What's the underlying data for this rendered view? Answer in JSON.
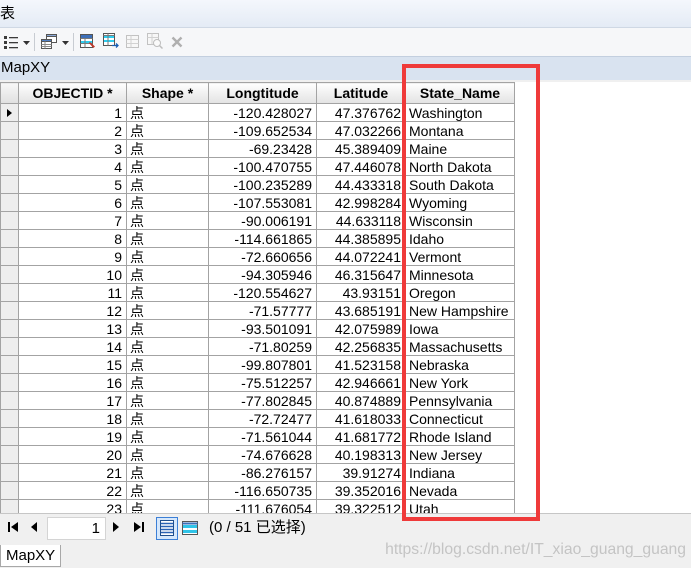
{
  "window": {
    "title": "表"
  },
  "toolbar": {
    "icons": [
      "table-options-icon",
      "related-tables-icon",
      "select-by-attributes-icon",
      "switch-selection-icon",
      "clear-selection-icon",
      "zoom-to-selected-icon",
      "delete-selected-icon"
    ],
    "disabled": [
      "clear-selection-icon",
      "zoom-to-selected-icon",
      "delete-selected-icon"
    ]
  },
  "table": {
    "name": "MapXY",
    "columns": [
      "OBJECTID *",
      "Shape *",
      "Longtitude",
      "Latitude",
      "State_Name"
    ],
    "current_row": 1,
    "rows": [
      [
        "1",
        "点",
        "-120.428027",
        "47.376762",
        "Washington"
      ],
      [
        "2",
        "点",
        "-109.652534",
        "47.032266",
        "Montana"
      ],
      [
        "3",
        "点",
        "-69.23428",
        "45.389409",
        "Maine"
      ],
      [
        "4",
        "点",
        "-100.470755",
        "47.446078",
        "North Dakota"
      ],
      [
        "5",
        "点",
        "-100.235289",
        "44.433318",
        "South Dakota"
      ],
      [
        "6",
        "点",
        "-107.553081",
        "42.998284",
        "Wyoming"
      ],
      [
        "7",
        "点",
        "-90.006191",
        "44.633118",
        "Wisconsin"
      ],
      [
        "8",
        "点",
        "-114.661865",
        "44.385895",
        "Idaho"
      ],
      [
        "9",
        "点",
        "-72.660656",
        "44.072241",
        "Vermont"
      ],
      [
        "10",
        "点",
        "-94.305946",
        "46.315647",
        "Minnesota"
      ],
      [
        "11",
        "点",
        "-120.554627",
        "43.93151",
        "Oregon"
      ],
      [
        "12",
        "点",
        "-71.57777",
        "43.685191",
        "New Hampshire"
      ],
      [
        "13",
        "点",
        "-93.501091",
        "42.075989",
        "Iowa"
      ],
      [
        "14",
        "点",
        "-71.80259",
        "42.256835",
        "Massachusetts"
      ],
      [
        "15",
        "点",
        "-99.807801",
        "41.523158",
        "Nebraska"
      ],
      [
        "16",
        "点",
        "-75.512257",
        "42.946661",
        "New York"
      ],
      [
        "17",
        "点",
        "-77.802845",
        "40.874889",
        "Pennsylvania"
      ],
      [
        "18",
        "点",
        "-72.72477",
        "41.618033",
        "Connecticut"
      ],
      [
        "19",
        "点",
        "-71.561044",
        "41.681772",
        "Rhode Island"
      ],
      [
        "20",
        "点",
        "-74.676628",
        "40.198313",
        "New Jersey"
      ],
      [
        "21",
        "点",
        "-86.276157",
        "39.91274",
        "Indiana"
      ],
      [
        "22",
        "点",
        "-116.650735",
        "39.352016",
        "Nevada"
      ],
      [
        "23",
        "点",
        "-111.676054",
        "39.322512",
        "Utah"
      ]
    ]
  },
  "navigator": {
    "icons": [
      "move-first-icon",
      "move-previous-icon",
      "move-next-icon",
      "move-last-icon",
      "show-all-records-icon",
      "show-selected-records-icon"
    ],
    "active_view": "show-all-records-icon",
    "current_record": "1",
    "status": "(0 / 51 已选择)"
  },
  "tabs": [
    "MapXY"
  ],
  "watermark": "https://blog.csdn.net/IT_xiao_guang_guang",
  "colors": {
    "highlight_box": "#ef3a3a",
    "grid_line": "#a3a3a3",
    "table_name_bar": "#d9e3f0",
    "active_view_border": "#3c7fd6"
  }
}
